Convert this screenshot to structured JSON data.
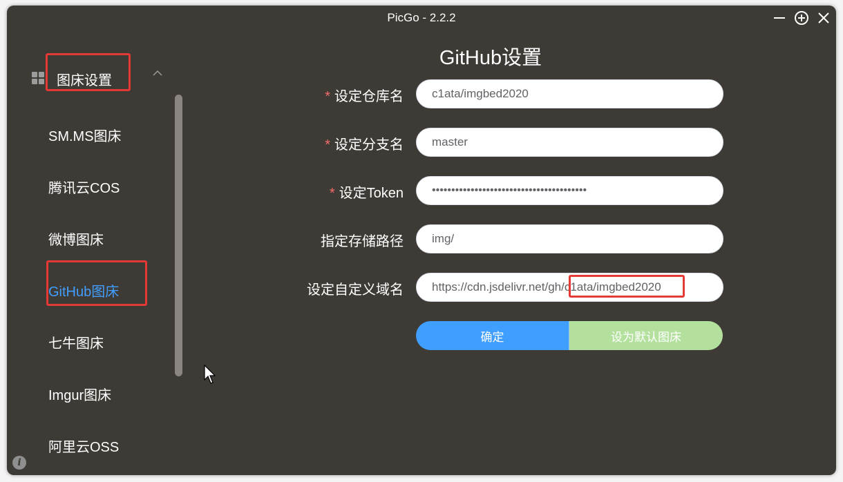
{
  "window": {
    "title": "PicGo - 2.2.2",
    "controls": [
      "minimize-icon",
      "maximize-icon",
      "close-icon"
    ]
  },
  "sidebar": {
    "section_label": "图床设置",
    "section_icon": "grid-icon",
    "section_expanded": true,
    "items": [
      {
        "label": "SM.MS图床"
      },
      {
        "label": "腾讯云COS"
      },
      {
        "label": "微博图床"
      },
      {
        "label": "GitHub图床",
        "active": true
      },
      {
        "label": "七牛图床"
      },
      {
        "label": "Imgur图床"
      },
      {
        "label": "阿里云OSS"
      }
    ],
    "info_icon": "info-icon"
  },
  "main": {
    "title": "GitHub设置",
    "required_mark": "*",
    "fields": [
      {
        "label": "设定仓库名",
        "required": true,
        "value": "c1ata/imgbed2020"
      },
      {
        "label": "设定分支名",
        "required": true,
        "value": "master"
      },
      {
        "label": "设定Token",
        "required": true,
        "value": "••••••••••••••••••••••••••••••••••••••••"
      },
      {
        "label": "指定存储路径",
        "required": false,
        "value": "img/"
      },
      {
        "label": "设定自定义域名",
        "required": false,
        "value": "https://cdn.jsdelivr.net/gh/c1ata/imgbed2020"
      }
    ],
    "confirm_label": "确定",
    "set_default_label": "设为默认图床"
  },
  "colors": {
    "background": "#3e3a35",
    "accent": "#409eff",
    "success_light": "#b3e19d",
    "required": "#f56c6c",
    "annotation": "#e53935"
  }
}
